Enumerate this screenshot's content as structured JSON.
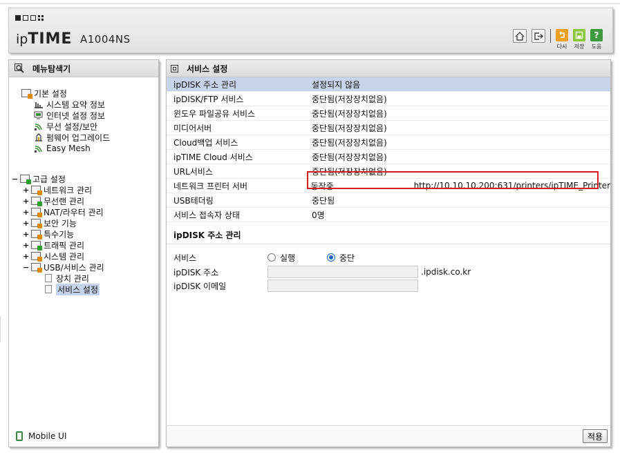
{
  "header": {
    "logo_prefix": "ip",
    "logo_main": "TIME",
    "model": "A1004NS",
    "buttons": [
      {
        "label": "다시",
        "icon": "undo-icon",
        "color": "#f0a020"
      },
      {
        "label": "저장",
        "icon": "save-icon",
        "color": "#8cc63f"
      },
      {
        "label": "도움",
        "icon": "help-icon",
        "color": "#3f9a3f"
      }
    ]
  },
  "sidebar": {
    "title": "메뉴탐색기",
    "basic": {
      "label": "기본 설정",
      "items": [
        "시스템 요약 정보",
        "인터넷 설정 정보",
        "무선 설정/보안",
        "펌웨어 업그레이드",
        "Easy Mesh"
      ]
    },
    "advanced": {
      "label": "고급 설정",
      "items": [
        "네트워크 관리",
        "무선랜 관리",
        "NAT/라우터 관리",
        "보안 기능",
        "특수기능",
        "트래픽 관리",
        "시스템 관리",
        "USB/서비스 관리"
      ],
      "sub_items": [
        "장치 관리",
        "서비스 설정"
      ],
      "selected": "서비스 설정"
    },
    "mobile": "Mobile UI"
  },
  "main": {
    "title": "서비스 설정",
    "rows": [
      {
        "name": "ipDISK 주소 관리",
        "status": "설정되지 않음",
        "extra": ""
      },
      {
        "name": "ipDISK/FTP 서비스",
        "status": "중단됨(저장장치없음)",
        "extra": ""
      },
      {
        "name": "윈도우 파일공유 서비스",
        "status": "중단됨(저장장치없음)",
        "extra": ""
      },
      {
        "name": "미디어서버",
        "status": "중단됨(저장장치없음)",
        "extra": ""
      },
      {
        "name": "Cloud백업 서비스",
        "status": "중단됨(저장장치없음)",
        "extra": ""
      },
      {
        "name": "ipTIME Cloud 서비스",
        "status": "중단됨(저장장치없음)",
        "extra": ""
      },
      {
        "name": "URL서비스",
        "status": "중단됨(저장장치없음)",
        "extra": ""
      },
      {
        "name": "네트워크 프린터 서버",
        "status": "동작중",
        "extra": "http://10.10.10.200:631/printers/ipTIME_Printer"
      },
      {
        "name": "USB테더링",
        "status": "중단됨",
        "extra": ""
      },
      {
        "name": "서비스 접속자 상태",
        "status": "0명",
        "extra": ""
      }
    ],
    "ipdisk": {
      "title": "ipDISK 주소 관리",
      "service_label": "서비스",
      "option_run": "실행",
      "option_stop": "중단",
      "selected": "중단",
      "address_label": "ipDISK 주소",
      "address_value": "",
      "domain_suffix": ".ipdisk.co.kr",
      "email_label": "ipDISK 이메일",
      "email_value": ""
    },
    "apply_label": "적용"
  }
}
